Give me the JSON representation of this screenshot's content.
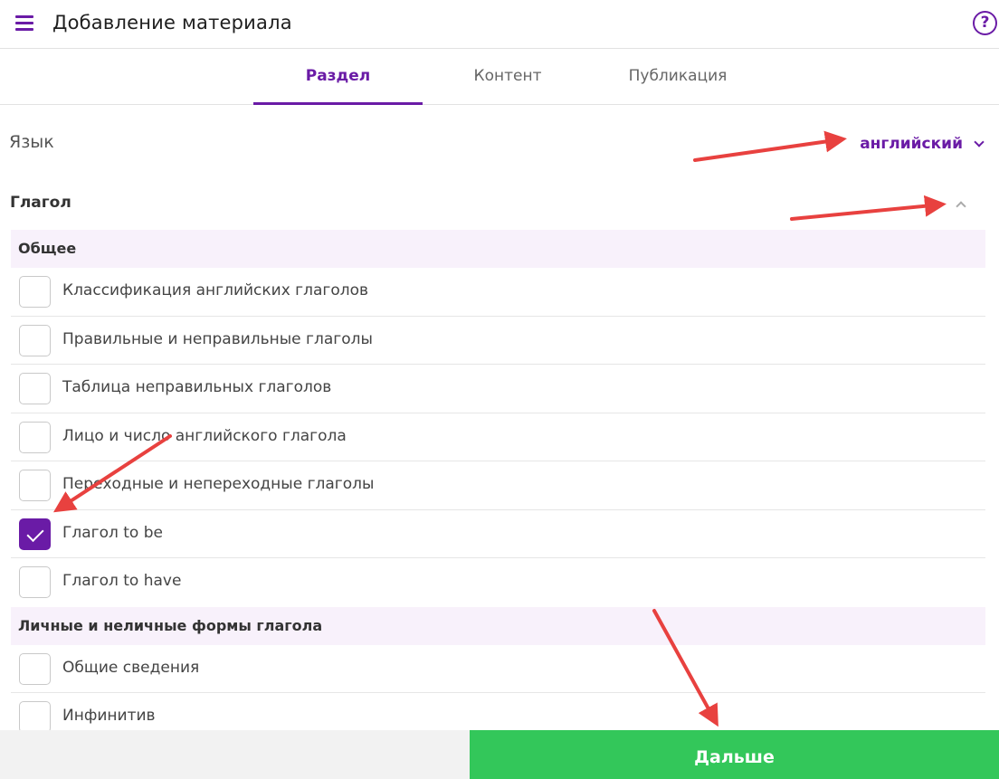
{
  "header": {
    "title": "Добавление материала",
    "help_label": "?"
  },
  "tabs": [
    {
      "label": "Раздел",
      "active": true
    },
    {
      "label": "Контент",
      "active": false
    },
    {
      "label": "Публикация",
      "active": false
    }
  ],
  "language": {
    "label": "Язык",
    "value": "английский"
  },
  "section": {
    "title": "Глагол",
    "groups": [
      {
        "title": "Общее",
        "items": [
          {
            "label": "Классификация английских глаголов",
            "checked": false
          },
          {
            "label": "Правильные и неправильные глаголы",
            "checked": false
          },
          {
            "label": "Таблица неправильных глаголов",
            "checked": false
          },
          {
            "label": "Лицо и число английского глагола",
            "checked": false
          },
          {
            "label": "Переходные и непереходные глаголы",
            "checked": false
          },
          {
            "label": "Глагол to be",
            "checked": true
          },
          {
            "label": "Глагол to have",
            "checked": false
          }
        ]
      },
      {
        "title": "Личные и неличные формы глагола",
        "items": [
          {
            "label": "Общие сведения",
            "checked": false
          },
          {
            "label": "Инфинитив",
            "checked": false
          }
        ]
      }
    ]
  },
  "footer": {
    "next_label": "Дальше"
  },
  "colors": {
    "accent": "#6a1ba6",
    "next_button": "#33c75a",
    "annotation_arrow": "#e8413f"
  }
}
